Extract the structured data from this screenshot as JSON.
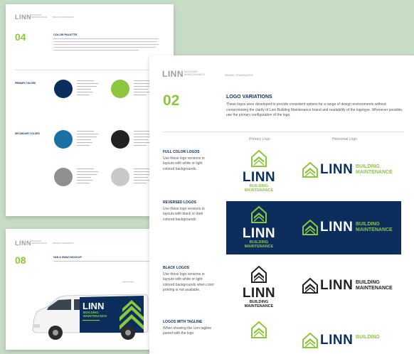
{
  "brand": {
    "wordmark": "LINN",
    "sub_line1": "BUILDING",
    "sub_line2": "MAINTENANCE",
    "standards": "BRAND STANDARDS",
    "colors": {
      "navy": "#0b2e5c",
      "green": "#8cc63f",
      "blue": "#1b6fa5",
      "black": "#222222",
      "gray": "#8f8f8f",
      "light_gray": "#c8c8c8"
    }
  },
  "page_color": {
    "number": "04",
    "title": "COLOR PALETTE",
    "primary_label": "PRIMARY COLORS",
    "secondary_label": "SECONDARY COLORS"
  },
  "page_logo": {
    "number": "02",
    "title": "LOGO VARIATIONS",
    "description": "These logos were developed to provide consistent options for a range of design environments without compromising the clarity of Linn Building Maintenance brand and readability of the logotype. Whenever possible, use the primary configuration of the logo.",
    "col_primary": "Primary Logo",
    "col_horizontal": "Horizontal Logo",
    "rows": [
      {
        "title": "FULL COLOR LOGOS",
        "desc": "Use these logo versions in layouts with white or light colored backgrounds."
      },
      {
        "title": "REVERSED LOGOS",
        "desc": "Use these logo versions in layouts with black or dark colored backgrounds."
      },
      {
        "title": "BLACK LOGOS",
        "desc": "Use these logo versions in layouts with white or light colored backgrounds when color printing is not available."
      },
      {
        "title": "LOGOS WITH TAGLINE",
        "desc": "When showing the Linn tagline paired with the logo"
      }
    ]
  },
  "page_van": {
    "number": "08",
    "title": "VAN & SWAG MOCKUP",
    "van_brand": "LINN",
    "van_sub1": "BUILDING",
    "van_sub2": "MAINTENANCE"
  },
  "icons": [
    "house-chevron-logo-icon"
  ]
}
